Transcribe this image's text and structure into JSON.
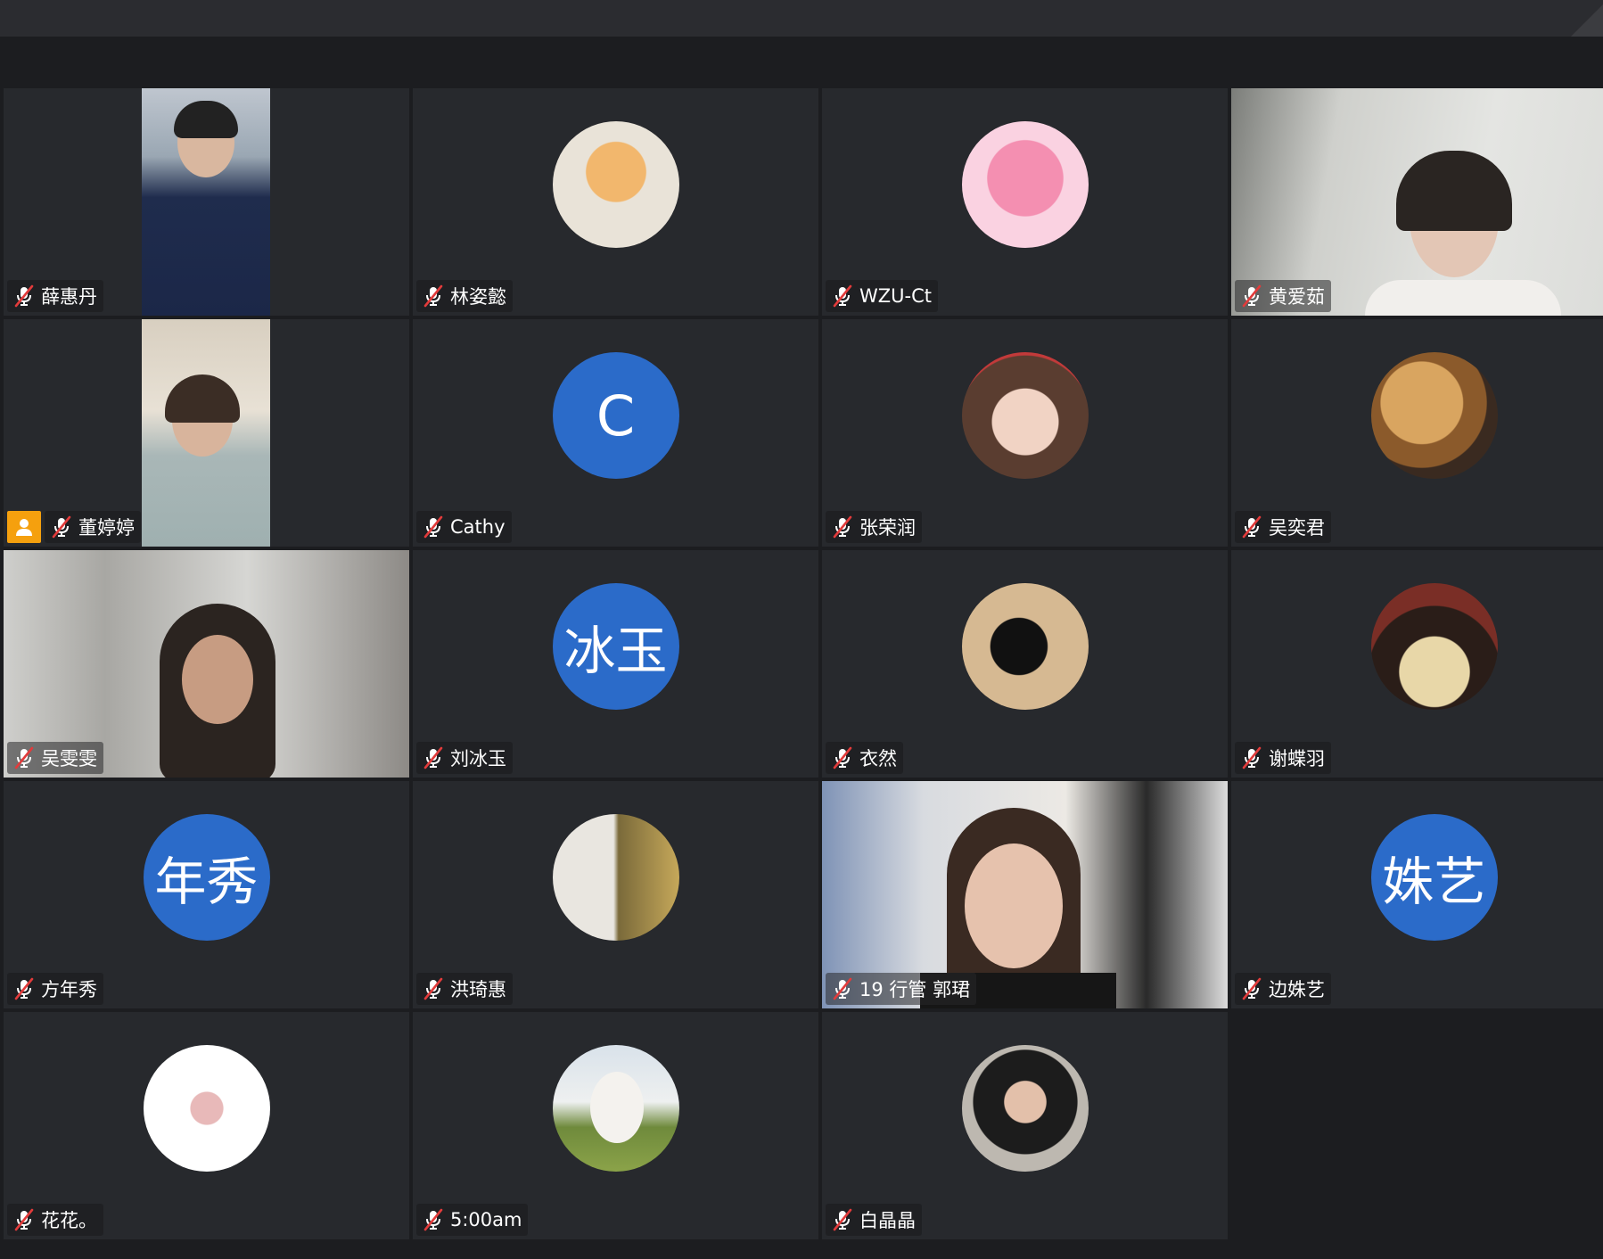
{
  "colors": {
    "avatar_blue": "#2b6bc9",
    "host_badge": "#f5a00e",
    "tile_bg": "#27292d"
  },
  "participants": [
    {
      "name": "薛惠丹",
      "type": "video",
      "muted": true
    },
    {
      "name": "林姿懿",
      "type": "photo-avatar",
      "muted": true
    },
    {
      "name": "WZU-Ct",
      "type": "photo-avatar",
      "muted": true
    },
    {
      "name": "黄爱茹",
      "type": "video",
      "muted": true
    },
    {
      "name": "董婷婷",
      "type": "video",
      "muted": true,
      "host": true
    },
    {
      "name": "Cathy",
      "type": "letter-avatar",
      "initials": "C",
      "muted": true
    },
    {
      "name": "张荣润",
      "type": "photo-avatar",
      "muted": true
    },
    {
      "name": "吴奕君",
      "type": "photo-avatar",
      "muted": true
    },
    {
      "name": "吴雯雯",
      "type": "video",
      "muted": true
    },
    {
      "name": "刘冰玉",
      "type": "letter-avatar",
      "initials": "冰玉",
      "muted": true
    },
    {
      "name": "衣然",
      "type": "photo-avatar",
      "muted": true
    },
    {
      "name": "谢蝶羽",
      "type": "photo-avatar",
      "muted": true
    },
    {
      "name": "方年秀",
      "type": "letter-avatar",
      "initials": "年秀",
      "muted": true
    },
    {
      "name": "洪琦惠",
      "type": "photo-avatar",
      "muted": true
    },
    {
      "name": "19 行管 郭珺",
      "type": "video",
      "muted": true
    },
    {
      "name": "边姝艺",
      "type": "letter-avatar",
      "initials": "姝艺",
      "muted": true
    },
    {
      "name": "花花。",
      "type": "photo-avatar",
      "muted": true
    },
    {
      "name": "5:00am",
      "type": "photo-avatar",
      "muted": true
    },
    {
      "name": "白晶晶",
      "type": "photo-avatar",
      "muted": true
    }
  ]
}
